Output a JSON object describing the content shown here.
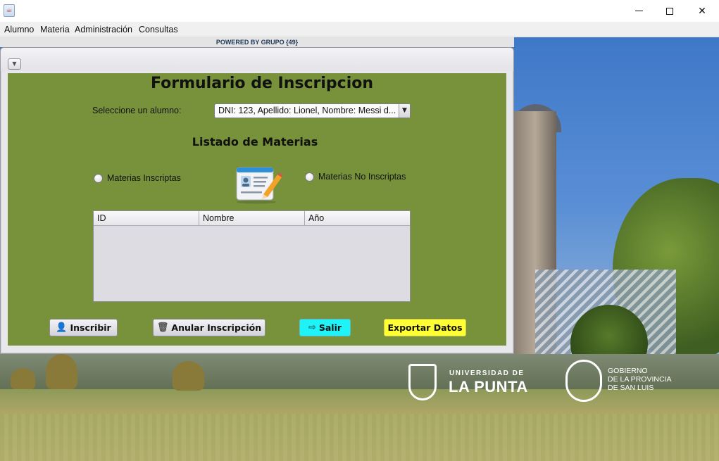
{
  "window": {
    "app_icon": "java-cup-icon",
    "controls": {
      "minimize": "minimize-icon",
      "maximize": "maximize-icon",
      "close": "✕"
    }
  },
  "menubar": {
    "items": [
      "Alumno",
      "Materia",
      "Administración",
      "Consultas"
    ]
  },
  "banner": {
    "powered_by": "POWERED BY GRUPO {49}"
  },
  "background": {
    "logo_ulp": {
      "top": "UNIVERSIDAD DE",
      "main": "LA PUNTA"
    },
    "logo_gob": {
      "line1": "GOBIERNO",
      "line2": "DE LA PROVINCIA",
      "line3": "DE SAN LUIS"
    }
  },
  "form": {
    "title": "Formulario de Inscripcion",
    "alumno_label": "Seleccione un alumno:",
    "alumno_selected": "DNI: 123, Apellido: Lionel, Nombre: Messi d...",
    "listado_title": "Listado de Materias",
    "radio_inscriptas": "Materias Inscriptas",
    "radio_no_inscriptas": "Materias No Inscriptas",
    "table": {
      "columns": [
        "ID",
        "Nombre",
        "Año"
      ],
      "rows": []
    },
    "buttons": {
      "inscribir": "Inscribir",
      "anular": "Anular Inscripción",
      "salir": "Salir",
      "exportar": "Exportar Datos"
    }
  },
  "colors": {
    "panel_bg": "#77923a",
    "salir_btn": "#1ef3f8",
    "exportar_btn": "#ffff33"
  }
}
